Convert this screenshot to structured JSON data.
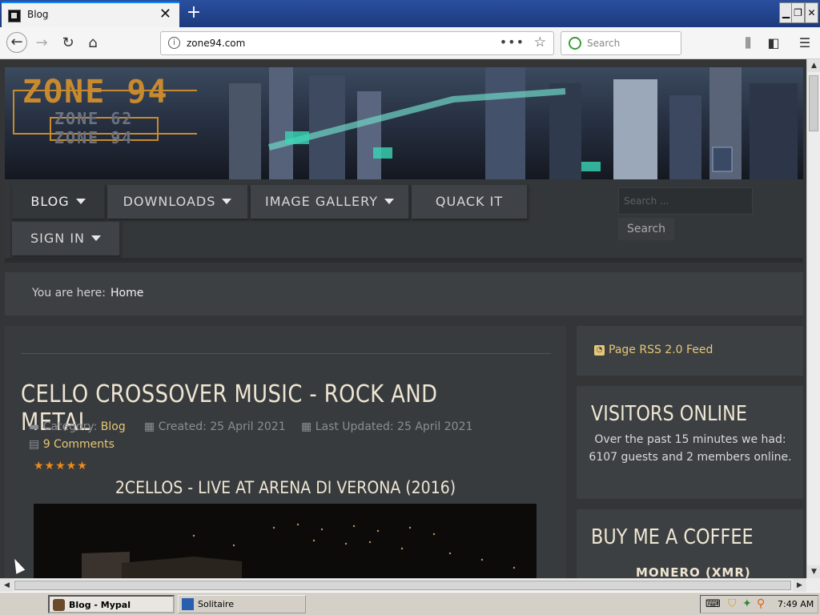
{
  "browser": {
    "tab_title": "Blog",
    "url": "zone94.com",
    "search_placeholder": "Search"
  },
  "taskbar": {
    "items": [
      {
        "label": "Blog - Mypal"
      },
      {
        "label": "Solitaire"
      }
    ],
    "clock": "7:49 AM"
  },
  "banner": {
    "logo_main": "ZONE 94",
    "logo_sub1": "ZONE 62",
    "logo_sub2": "ZONE 94"
  },
  "menu": {
    "items": [
      {
        "label": "BLOG"
      },
      {
        "label": "DOWNLOADS"
      },
      {
        "label": "IMAGE GALLERY"
      },
      {
        "label": "QUACK IT"
      },
      {
        "label": "SIGN IN"
      }
    ],
    "search_placeholder": "Search ...",
    "search_button": "Search"
  },
  "breadcrumb": {
    "prefix": "You are here:",
    "current": "Home"
  },
  "article": {
    "title": "CELLO CROSSOVER MUSIC - ROCK AND METAL",
    "category_label": "Category:",
    "category": "Blog",
    "created": "Created: 25 April 2021",
    "updated": "Last Updated: 25 April 2021",
    "comments": "9 Comments",
    "rating": 5,
    "subtitle": "2CELLOS - LIVE AT ARENA DI VERONA (2016)"
  },
  "sidebar": {
    "rss": "Page RSS 2.0 Feed",
    "visitors_title": "VISITORS ONLINE",
    "visitors_text": "Over the past 15 minutes we had: 6107 guests and 2 members online.",
    "coffee_title": "BUY ME A COFFEE",
    "coffee_sub": "MONERO (XMR)"
  },
  "colors": {
    "accent": "#e5c775",
    "star": "#f08a18",
    "heading": "#efe6d2",
    "tab_accent": "#0a84ff"
  }
}
